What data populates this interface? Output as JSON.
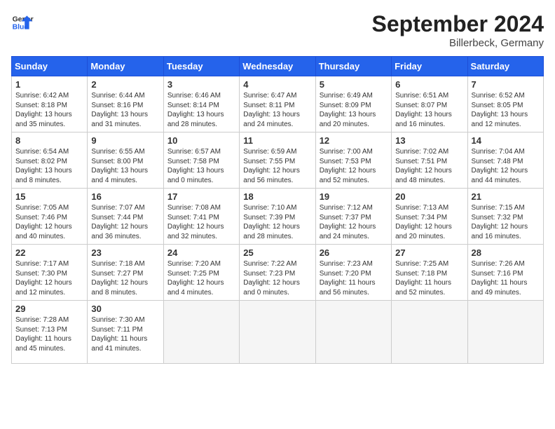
{
  "header": {
    "logo_line1": "General",
    "logo_line2": "Blue",
    "month_year": "September 2024",
    "location": "Billerbeck, Germany"
  },
  "days_of_week": [
    "Sunday",
    "Monday",
    "Tuesday",
    "Wednesday",
    "Thursday",
    "Friday",
    "Saturday"
  ],
  "weeks": [
    [
      {
        "day": 1,
        "lines": [
          "Sunrise: 6:42 AM",
          "Sunset: 8:18 PM",
          "Daylight: 13 hours",
          "and 35 minutes."
        ]
      },
      {
        "day": 2,
        "lines": [
          "Sunrise: 6:44 AM",
          "Sunset: 8:16 PM",
          "Daylight: 13 hours",
          "and 31 minutes."
        ]
      },
      {
        "day": 3,
        "lines": [
          "Sunrise: 6:46 AM",
          "Sunset: 8:14 PM",
          "Daylight: 13 hours",
          "and 28 minutes."
        ]
      },
      {
        "day": 4,
        "lines": [
          "Sunrise: 6:47 AM",
          "Sunset: 8:11 PM",
          "Daylight: 13 hours",
          "and 24 minutes."
        ]
      },
      {
        "day": 5,
        "lines": [
          "Sunrise: 6:49 AM",
          "Sunset: 8:09 PM",
          "Daylight: 13 hours",
          "and 20 minutes."
        ]
      },
      {
        "day": 6,
        "lines": [
          "Sunrise: 6:51 AM",
          "Sunset: 8:07 PM",
          "Daylight: 13 hours",
          "and 16 minutes."
        ]
      },
      {
        "day": 7,
        "lines": [
          "Sunrise: 6:52 AM",
          "Sunset: 8:05 PM",
          "Daylight: 13 hours",
          "and 12 minutes."
        ]
      }
    ],
    [
      {
        "day": 8,
        "lines": [
          "Sunrise: 6:54 AM",
          "Sunset: 8:02 PM",
          "Daylight: 13 hours",
          "and 8 minutes."
        ]
      },
      {
        "day": 9,
        "lines": [
          "Sunrise: 6:55 AM",
          "Sunset: 8:00 PM",
          "Daylight: 13 hours",
          "and 4 minutes."
        ]
      },
      {
        "day": 10,
        "lines": [
          "Sunrise: 6:57 AM",
          "Sunset: 7:58 PM",
          "Daylight: 13 hours",
          "and 0 minutes."
        ]
      },
      {
        "day": 11,
        "lines": [
          "Sunrise: 6:59 AM",
          "Sunset: 7:55 PM",
          "Daylight: 12 hours",
          "and 56 minutes."
        ]
      },
      {
        "day": 12,
        "lines": [
          "Sunrise: 7:00 AM",
          "Sunset: 7:53 PM",
          "Daylight: 12 hours",
          "and 52 minutes."
        ]
      },
      {
        "day": 13,
        "lines": [
          "Sunrise: 7:02 AM",
          "Sunset: 7:51 PM",
          "Daylight: 12 hours",
          "and 48 minutes."
        ]
      },
      {
        "day": 14,
        "lines": [
          "Sunrise: 7:04 AM",
          "Sunset: 7:48 PM",
          "Daylight: 12 hours",
          "and 44 minutes."
        ]
      }
    ],
    [
      {
        "day": 15,
        "lines": [
          "Sunrise: 7:05 AM",
          "Sunset: 7:46 PM",
          "Daylight: 12 hours",
          "and 40 minutes."
        ]
      },
      {
        "day": 16,
        "lines": [
          "Sunrise: 7:07 AM",
          "Sunset: 7:44 PM",
          "Daylight: 12 hours",
          "and 36 minutes."
        ]
      },
      {
        "day": 17,
        "lines": [
          "Sunrise: 7:08 AM",
          "Sunset: 7:41 PM",
          "Daylight: 12 hours",
          "and 32 minutes."
        ]
      },
      {
        "day": 18,
        "lines": [
          "Sunrise: 7:10 AM",
          "Sunset: 7:39 PM",
          "Daylight: 12 hours",
          "and 28 minutes."
        ]
      },
      {
        "day": 19,
        "lines": [
          "Sunrise: 7:12 AM",
          "Sunset: 7:37 PM",
          "Daylight: 12 hours",
          "and 24 minutes."
        ]
      },
      {
        "day": 20,
        "lines": [
          "Sunrise: 7:13 AM",
          "Sunset: 7:34 PM",
          "Daylight: 12 hours",
          "and 20 minutes."
        ]
      },
      {
        "day": 21,
        "lines": [
          "Sunrise: 7:15 AM",
          "Sunset: 7:32 PM",
          "Daylight: 12 hours",
          "and 16 minutes."
        ]
      }
    ],
    [
      {
        "day": 22,
        "lines": [
          "Sunrise: 7:17 AM",
          "Sunset: 7:30 PM",
          "Daylight: 12 hours",
          "and 12 minutes."
        ]
      },
      {
        "day": 23,
        "lines": [
          "Sunrise: 7:18 AM",
          "Sunset: 7:27 PM",
          "Daylight: 12 hours",
          "and 8 minutes."
        ]
      },
      {
        "day": 24,
        "lines": [
          "Sunrise: 7:20 AM",
          "Sunset: 7:25 PM",
          "Daylight: 12 hours",
          "and 4 minutes."
        ]
      },
      {
        "day": 25,
        "lines": [
          "Sunrise: 7:22 AM",
          "Sunset: 7:23 PM",
          "Daylight: 12 hours",
          "and 0 minutes."
        ]
      },
      {
        "day": 26,
        "lines": [
          "Sunrise: 7:23 AM",
          "Sunset: 7:20 PM",
          "Daylight: 11 hours",
          "and 56 minutes."
        ]
      },
      {
        "day": 27,
        "lines": [
          "Sunrise: 7:25 AM",
          "Sunset: 7:18 PM",
          "Daylight: 11 hours",
          "and 52 minutes."
        ]
      },
      {
        "day": 28,
        "lines": [
          "Sunrise: 7:26 AM",
          "Sunset: 7:16 PM",
          "Daylight: 11 hours",
          "and 49 minutes."
        ]
      }
    ],
    [
      {
        "day": 29,
        "lines": [
          "Sunrise: 7:28 AM",
          "Sunset: 7:13 PM",
          "Daylight: 11 hours",
          "and 45 minutes."
        ]
      },
      {
        "day": 30,
        "lines": [
          "Sunrise: 7:30 AM",
          "Sunset: 7:11 PM",
          "Daylight: 11 hours",
          "and 41 minutes."
        ]
      },
      null,
      null,
      null,
      null,
      null
    ]
  ]
}
